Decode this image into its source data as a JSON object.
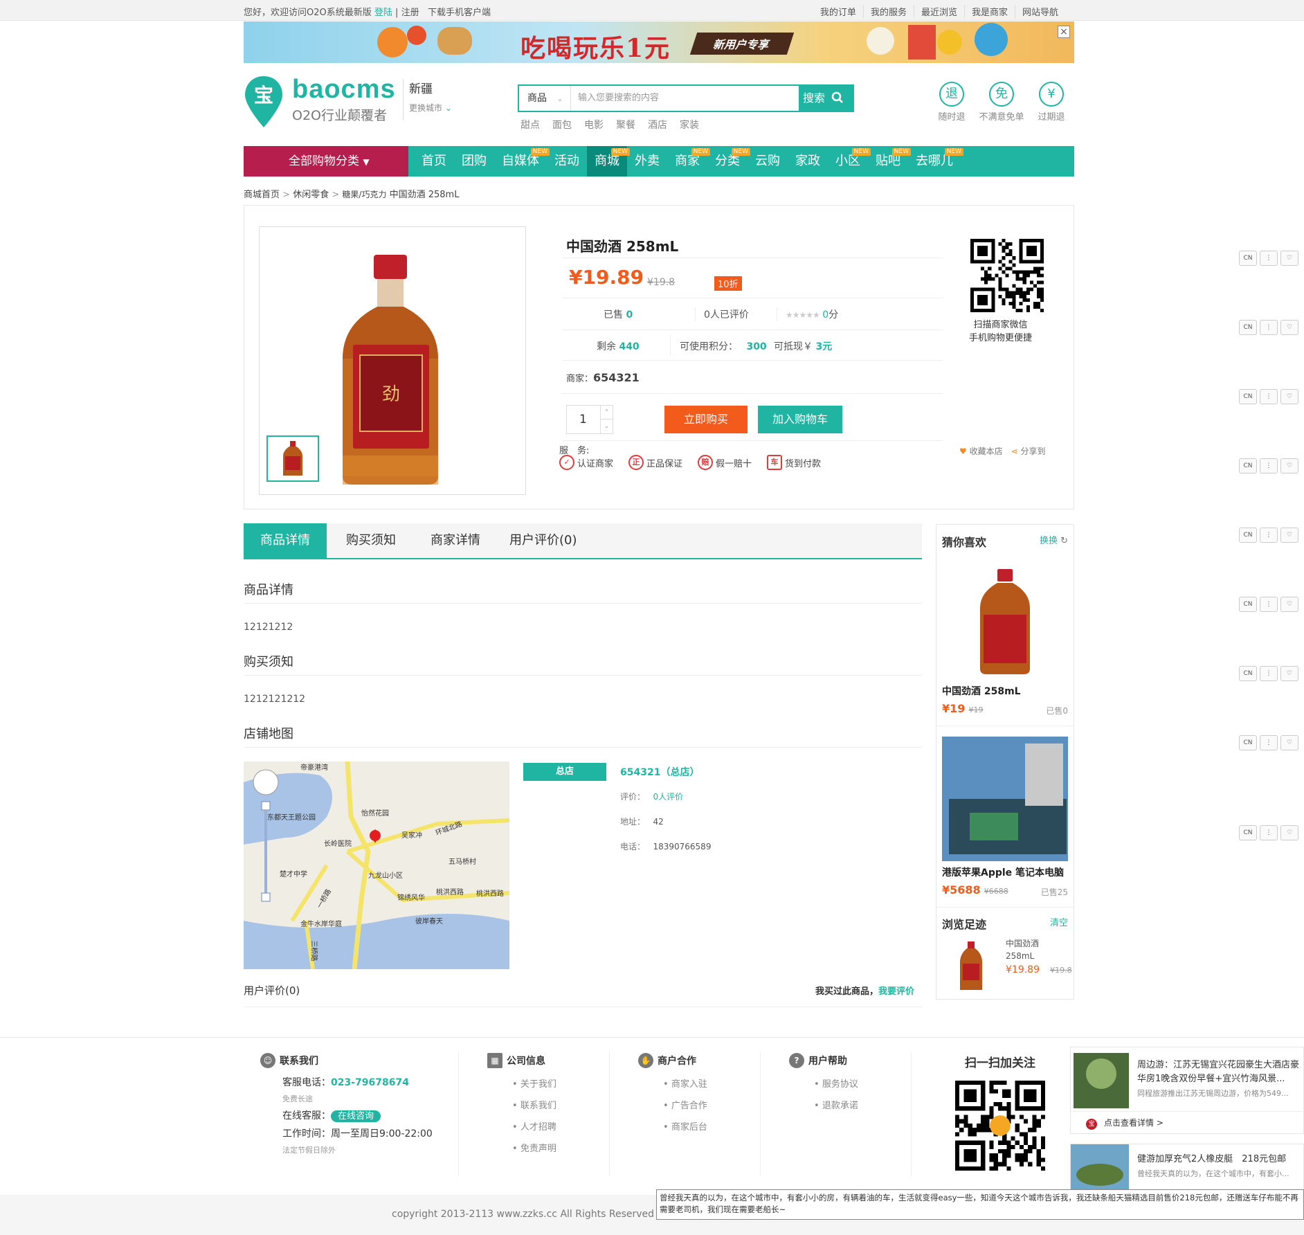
{
  "topbar": {
    "welcome": "您好，欢迎访问O2O系统最新版",
    "login": "登陆",
    "sep": "|",
    "register": "注册",
    "download": "下载手机客户端",
    "right_links": [
      "我的订单",
      "我的服务",
      "最近浏览",
      "我是商家",
      "网站导航"
    ]
  },
  "banner": {
    "text": "吃喝玩乐1元",
    "tag": "新用户专享",
    "close": "×"
  },
  "logo": {
    "name": "baocms",
    "slogan": "O2O行业颠覆者",
    "pin_char": "宝"
  },
  "city": {
    "name": "新疆",
    "change": "更换城市"
  },
  "search": {
    "category": "商品",
    "placeholder": "输入您要搜索的内容",
    "button": "搜索",
    "hot": [
      "甜点",
      "面包",
      "电影",
      "聚餐",
      "酒店",
      "家装"
    ]
  },
  "promises": [
    {
      "icon": "退",
      "label": "随时退"
    },
    {
      "icon": "免",
      "label": "不满意免单"
    },
    {
      "icon": "¥",
      "label": "过期退"
    }
  ],
  "nav": {
    "all_categories": "全部购物分类",
    "items": [
      {
        "label": "首页",
        "new": false
      },
      {
        "label": "团购",
        "new": false
      },
      {
        "label": "自媒体",
        "new": true
      },
      {
        "label": "活动",
        "new": false
      },
      {
        "label": "商城",
        "new": true,
        "active": true
      },
      {
        "label": "外卖",
        "new": false
      },
      {
        "label": "商家",
        "new": true
      },
      {
        "label": "分类",
        "new": true
      },
      {
        "label": "云购",
        "new": false
      },
      {
        "label": "家政",
        "new": false
      },
      {
        "label": "小区",
        "new": true
      },
      {
        "label": "贴吧",
        "new": true
      },
      {
        "label": "去哪儿",
        "new": true
      }
    ],
    "new_badge": "NEW"
  },
  "breadcrumb": [
    "商城首页",
    "休闲零食",
    "糖果/巧克力",
    "中国劲酒 258mL"
  ],
  "product": {
    "title": "中国劲酒 258mL",
    "price": "¥19.89",
    "old_price": "¥19.8",
    "discount": "10折",
    "sold_label": "已售",
    "sold": "0",
    "reviews": "0人已评价",
    "score": "0",
    "score_unit": "分",
    "stock_label": "剩余",
    "stock": "440",
    "points_label": "可使用积分：",
    "points": "300",
    "cash_label": "可抵现￥",
    "cash": "3元",
    "merchant_label": "商家：",
    "merchant": "654321",
    "quantity": "1",
    "buy_now": "立即购买",
    "add_cart": "加入购物车",
    "service_label": "服　务:",
    "services": [
      {
        "icon": "✓",
        "label": "认证商家"
      },
      {
        "icon": "正",
        "label": "正品保证"
      },
      {
        "icon": "赔",
        "label": "假一赔十"
      },
      {
        "icon": "车",
        "label": "货到付款"
      }
    ],
    "qr_caption_1": "扫描商家微信",
    "qr_caption_2": "手机购物更便捷",
    "favorite": "收藏本店",
    "share": "分享到"
  },
  "tabs": [
    "商品详情",
    "购买须知",
    "商家详情",
    "用户评价(0)"
  ],
  "sections": {
    "detail_title": "商品详情",
    "detail_text": "12121212",
    "notice_title": "购买须知",
    "notice_text": "1212121212",
    "map_title": "店铺地图"
  },
  "map_labels": [
    "帝豪港湾",
    "东都天王题公园",
    "怡然花园",
    "吴家冲",
    "环城北路",
    "长岭医院",
    "五马桥村",
    "楚才中学",
    "九龙山小区",
    "锦绣风华",
    "桃洪西路",
    "桃洪西路",
    "金牛水岸华庭",
    "彼岸春天",
    "一桥路",
    "三桥路"
  ],
  "store": {
    "badge": "总店",
    "name": "654321（总店）",
    "rating_label": "评价：",
    "rating": "0人评价",
    "address_label": "地址：",
    "address": "42",
    "phone_label": "电话：",
    "phone": "18390766589"
  },
  "user_reviews": {
    "title": "用户评价(0)",
    "bought": "我买过此商品，",
    "review_link": "我要评价"
  },
  "sidebar": {
    "guess_title": "猜你喜欢",
    "refresh": "换换",
    "items": [
      {
        "name": "中国劲酒 258mL",
        "price": "¥19",
        "old": "¥19",
        "sold": "已售0"
      },
      {
        "name": "港版苹果Apple 笔记本电脑",
        "price": "¥5688",
        "old": "¥6688",
        "sold": "已售25"
      }
    ],
    "history_title": "浏览足迹",
    "clear": "清空",
    "history": {
      "name_1": "中国劲酒",
      "name_2": "258mL",
      "price": "¥19.89",
      "old": "¥19.8"
    }
  },
  "rightrail": {
    "a": "CN",
    "b": "⋮",
    "c": "♡"
  },
  "footer": {
    "contact_title": "联系我们",
    "phone_label": "客服电话：",
    "phone": "023-79678674",
    "free": "免费长途",
    "online_label": "在线客服：",
    "online_btn": "在线咨询",
    "hours": "工作时间：周一至周日9:00-22:00",
    "holiday": "法定节假日除外",
    "company_title": "公司信息",
    "company_links": [
      "关于我们",
      "联系我们",
      "人才招聘",
      "免责声明"
    ],
    "merchant_title": "商户合作",
    "merchant_links": [
      "商家入驻",
      "广告合作",
      "商家后台"
    ],
    "help_title": "用户帮助",
    "help_links": [
      "服务协议",
      "退款承诺"
    ],
    "scan_title": "扫一扫加关注",
    "copyright": "copyright 2013-2113 www.zzks.cc All Rights Reserved O2"
  },
  "ads": [
    {
      "title": "周边游：江苏无锡宜兴花园豪生大酒店豪华房1晚含双份早餐+宜兴竹海风景...",
      "desc": "同程旅游推出江苏无锡周边游，价格为549...",
      "link": "点击查看详情 >"
    },
    {
      "title": "健游加厚充气2人橡皮艇　218元包邮",
      "desc": "曾经我天真的以为，在这个城市中，有套小..."
    }
  ],
  "tooltip": "曾经我天真的以为，在这个城市中，有套小小的房，有辆着油的车，生活就变得easy一些，知道今天这个城市告诉我，我还缺条船天猫精选目前售价218元包邮，还赠送车仔布能不再需要老司机，我们现在需要老船长~"
}
